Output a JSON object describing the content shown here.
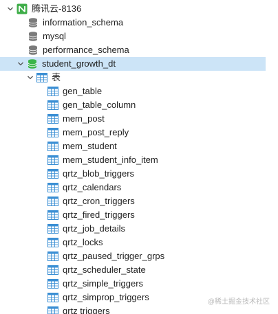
{
  "connection": {
    "label": "腾讯云-8136",
    "icon": "connection-icon",
    "color": "#3fae49"
  },
  "databases": [
    {
      "label": "information_schema",
      "icon": "database-icon"
    },
    {
      "label": "mysql",
      "icon": "database-icon"
    },
    {
      "label": "performance_schema",
      "icon": "database-icon"
    },
    {
      "label": "student_growth_dt",
      "icon": "database-icon-active",
      "selected": true
    }
  ],
  "tables_group": {
    "label": "表",
    "icon": "table-group-icon"
  },
  "tables": [
    "gen_table",
    "gen_table_column",
    "mem_post",
    "mem_post_reply",
    "mem_student",
    "mem_student_info_item",
    "qrtz_blob_triggers",
    "qrtz_calendars",
    "qrtz_cron_triggers",
    "qrtz_fired_triggers",
    "qrtz_job_details",
    "qrtz_locks",
    "qrtz_paused_trigger_grps",
    "qrtz_scheduler_state",
    "qrtz_simple_triggers",
    "qrtz_simprop_triggers",
    "qrtz triggers"
  ],
  "colors": {
    "selection": "#cce4f7",
    "database_gray": "#7b7b7b",
    "database_active": "#39b54a",
    "table_blue": "#3b8fd4"
  },
  "watermark": "@稀土掘金技术社区"
}
